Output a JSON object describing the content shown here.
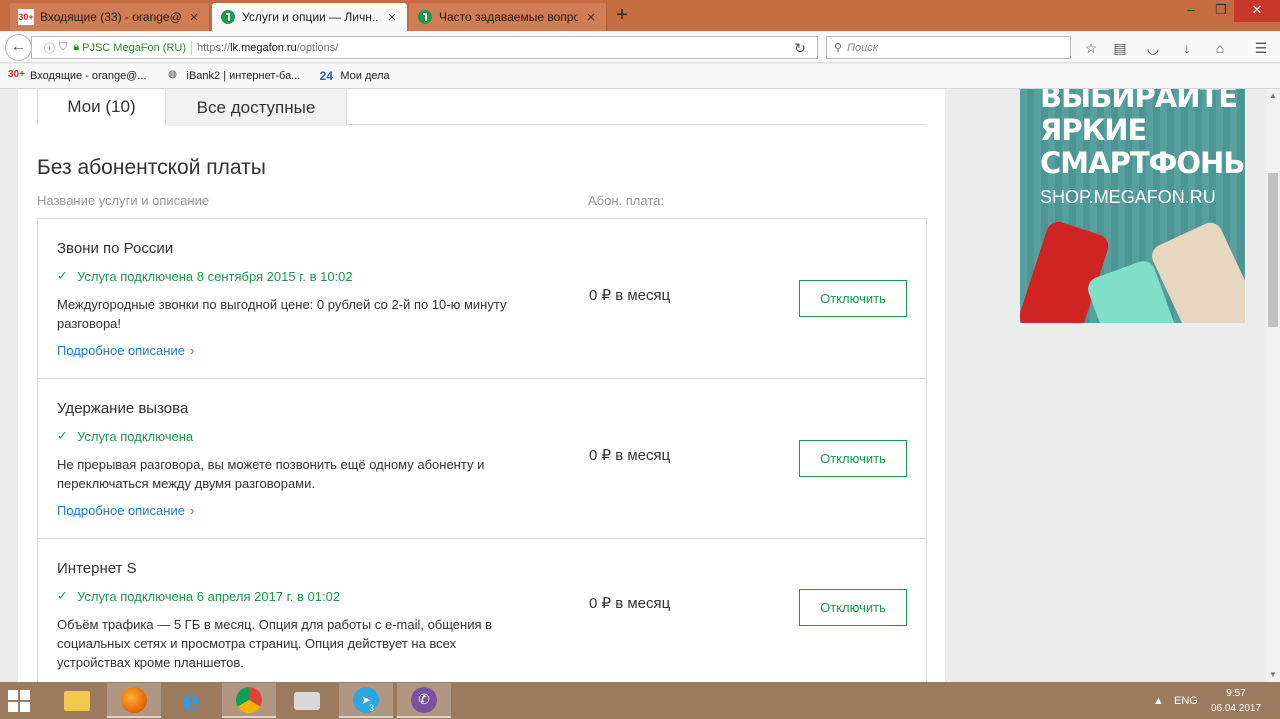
{
  "browser": {
    "tabs": [
      {
        "title": "Входящие (33) - orange@...",
        "favicon_text": "30+"
      },
      {
        "title": "Услуги и опции — Личн...",
        "active": true
      },
      {
        "title": "Часто задаваемые вопро..."
      }
    ],
    "url": {
      "identity": "PJSC MegaFon (RU)",
      "scheme": "https://",
      "host": "lk.megafon.ru",
      "path": "/options/"
    },
    "search_placeholder": "Поиск",
    "bookmarks": [
      {
        "label": "Входящие - orange@...",
        "icon_text": "30+"
      },
      {
        "label": "iBank2 | интернет-ба..."
      },
      {
        "label": "Мои дела",
        "icon_text": "24"
      }
    ]
  },
  "page": {
    "tabs": [
      {
        "label": "Мои (10)",
        "selected": true
      },
      {
        "label": "Все доступные"
      }
    ],
    "section_title": "Без абонентской платы",
    "col_name": "Название услуги и описание",
    "col_fee": "Абон. плата:",
    "services": [
      {
        "name": "Звони по России",
        "status": "Услуга подключена 8 сентября 2015 г. в 10:02",
        "desc": "Междугородные звонки по выгодной цене: 0 рублей со 2-й по 10-ю минуту разговора!",
        "more": "Подробное описание",
        "fee": "0 ₽ в месяц",
        "action": "Отключить"
      },
      {
        "name": "Удержание вызова",
        "status": "Услуга подключена",
        "desc": "Не прерывая разговора, вы можете позвонить ещё одному абоненту и переключаться между двумя разговорами.",
        "more": "Подробное описание",
        "fee": "0 ₽ в месяц",
        "action": "Отключить"
      },
      {
        "name": "Интернет S",
        "status": "Услуга подключена 6 апреля 2017 г. в 01:02",
        "desc": "Объём трафика — 5 ГБ в месяц. Опция для работы с e-mail, общения в социальных сетях и просмотра страниц. Опция действует на всех устройствах кроме планшетов.",
        "fee": "0 ₽ в месяц",
        "action": "Отключить"
      }
    ],
    "ad": {
      "headline": "ВЫБИРАЙТЕ\nЯРКИЕ\nСМАРТФОНЫ",
      "site": "SHOP.MEGAFON.RU"
    }
  },
  "taskbar": {
    "lang": "ENG",
    "time": "9:57",
    "date": "06.04.2017",
    "telegram_badge": "3"
  },
  "colors": {
    "brand_green": "#1a9b4b",
    "link_blue": "#1b7fc4",
    "tabbar": "#c66c43"
  }
}
